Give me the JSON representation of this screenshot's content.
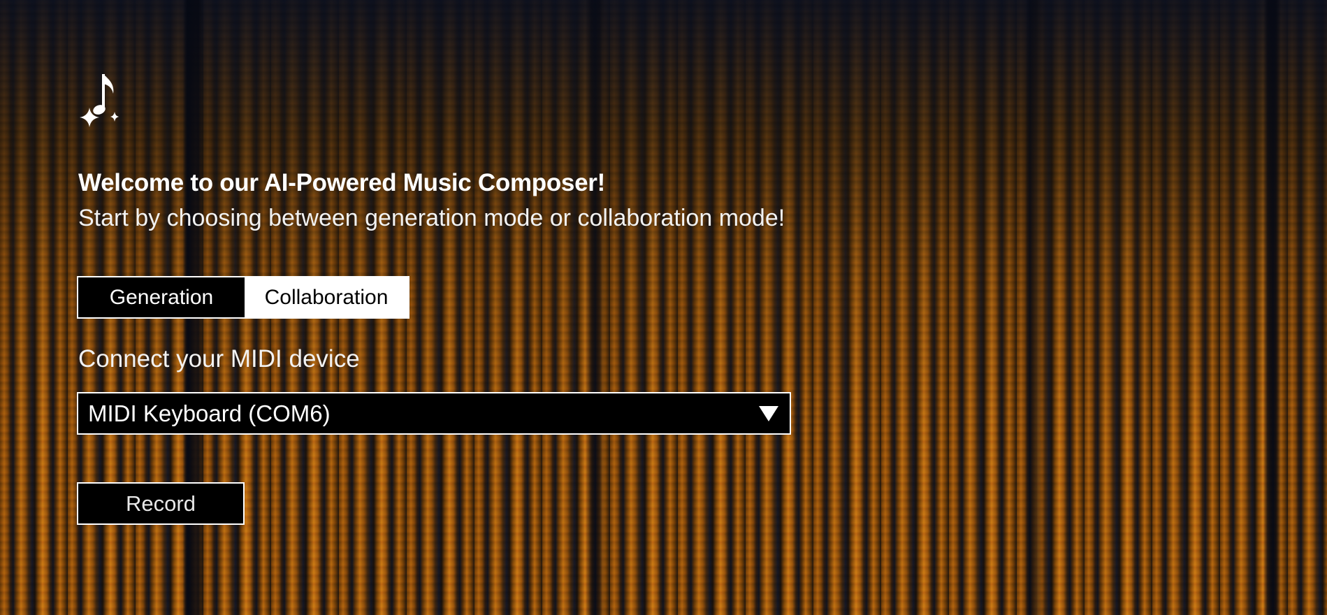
{
  "app": {
    "logo_icon": "music-note-sparkle-icon"
  },
  "header": {
    "title": "Welcome to our AI-Powered Music Composer!",
    "subtitle": "Start by choosing between generation mode or collaboration mode!"
  },
  "mode_toggle": {
    "options": [
      {
        "label": "Generation",
        "selected": true
      },
      {
        "label": "Collaboration",
        "selected": false
      }
    ]
  },
  "midi": {
    "label": "Connect your MIDI device",
    "selected_device": "MIDI Keyboard (COM6)",
    "dropdown_icon": "triangle-down-icon"
  },
  "record": {
    "label": "Record"
  },
  "colors": {
    "accent": "#ffffff",
    "button_bg": "#000000",
    "background_warm": "#c27212",
    "background_dark": "#0d1220"
  }
}
